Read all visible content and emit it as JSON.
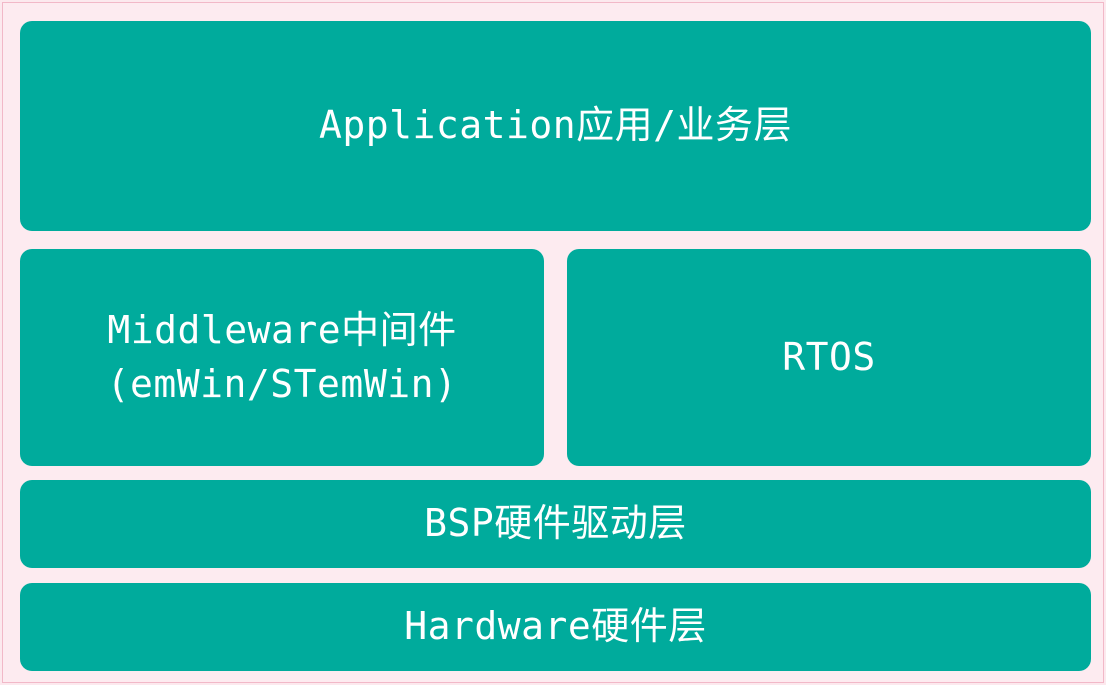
{
  "diagram": {
    "layers": {
      "application": "Application应用/业务层",
      "middleware_line1": "Middleware中间件",
      "middleware_line2": "(emWin/STemWin)",
      "rtos": "RTOS",
      "bsp": "BSP硬件驱动层",
      "hardware": "Hardware硬件层"
    },
    "colors": {
      "block_fill": "#00ab9c",
      "text": "#ffffff",
      "background": "#fdebf0",
      "border": "#f2b8c8"
    }
  }
}
